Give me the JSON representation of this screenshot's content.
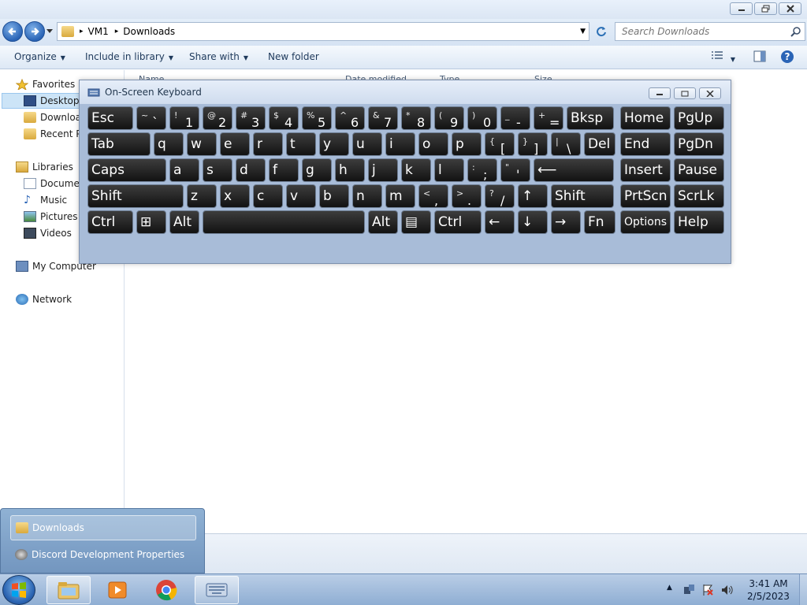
{
  "explorer": {
    "address": {
      "segments": [
        "VM1",
        "Downloads"
      ]
    },
    "search": {
      "placeholder": "Search Downloads"
    },
    "toolbar": {
      "organize": "Organize",
      "include": "Include in library",
      "share": "Share with",
      "new_folder": "New folder"
    },
    "columns": [
      "Name",
      "Date modified",
      "Type",
      "Size"
    ],
    "sidebar": {
      "favorites": "Favorites",
      "desktop": "Desktop",
      "downloads": "Downloads",
      "recent": "Recent Places",
      "libraries": "Libraries",
      "documents": "Documents",
      "music": "Music",
      "pictures": "Pictures",
      "videos": "Videos",
      "computer": "My Computer",
      "network": "Network"
    }
  },
  "osk": {
    "title": "On-Screen Keyboard",
    "rows": [
      [
        {
          "l": "Esc"
        },
        {
          "s": "~",
          "m": "`"
        },
        {
          "s": "!",
          "m": "1"
        },
        {
          "s": "@",
          "m": "2"
        },
        {
          "s": "#",
          "m": "3"
        },
        {
          "s": "$",
          "m": "4"
        },
        {
          "s": "%",
          "m": "5"
        },
        {
          "s": "^",
          "m": "6"
        },
        {
          "s": "&",
          "m": "7"
        },
        {
          "s": "*",
          "m": "8"
        },
        {
          "s": "(",
          "m": "9"
        },
        {
          "s": ")",
          "m": "0"
        },
        {
          "s": "_",
          "m": "-"
        },
        {
          "s": "+",
          "m": "="
        },
        {
          "l": "Bksp"
        },
        {
          "l": "Home"
        },
        {
          "l": "PgUp"
        }
      ],
      [
        {
          "l": "Tab"
        },
        {
          "l": "q"
        },
        {
          "l": "w"
        },
        {
          "l": "e"
        },
        {
          "l": "r"
        },
        {
          "l": "t"
        },
        {
          "l": "y"
        },
        {
          "l": "u"
        },
        {
          "l": "i"
        },
        {
          "l": "o"
        },
        {
          "l": "p"
        },
        {
          "s": "{",
          "m": "["
        },
        {
          "s": "}",
          "m": "]"
        },
        {
          "s": "|",
          "m": "\\"
        },
        {
          "l": "Del"
        },
        {
          "l": "End"
        },
        {
          "l": "PgDn"
        }
      ],
      [
        {
          "l": "Caps"
        },
        {
          "l": "a"
        },
        {
          "l": "s"
        },
        {
          "l": "d"
        },
        {
          "l": "f"
        },
        {
          "l": "g"
        },
        {
          "l": "h"
        },
        {
          "l": "j"
        },
        {
          "l": "k"
        },
        {
          "l": "l"
        },
        {
          "s": ":",
          "m": ";"
        },
        {
          "s": "\"",
          "m": "'"
        },
        {
          "l": "⟵"
        },
        {
          "l": "Insert"
        },
        {
          "l": "Pause"
        }
      ],
      [
        {
          "l": "Shift"
        },
        {
          "l": "z"
        },
        {
          "l": "x"
        },
        {
          "l": "c"
        },
        {
          "l": "v"
        },
        {
          "l": "b"
        },
        {
          "l": "n"
        },
        {
          "l": "m"
        },
        {
          "s": "<",
          "m": ","
        },
        {
          "s": ">",
          "m": "."
        },
        {
          "s": "?",
          "m": "/"
        },
        {
          "l": "↑"
        },
        {
          "l": "Shift"
        },
        {
          "l": "PrtScn"
        },
        {
          "l": "ScrLk"
        }
      ],
      [
        {
          "l": "Ctrl"
        },
        {
          "l": "⊞"
        },
        {
          "l": "Alt"
        },
        {
          "l": ""
        },
        {
          "l": "Alt"
        },
        {
          "l": "▤"
        },
        {
          "l": "Ctrl"
        },
        {
          "l": "←"
        },
        {
          "l": "↓"
        },
        {
          "l": "→"
        },
        {
          "l": "Fn"
        },
        {
          "l": "Options"
        },
        {
          "l": "Help"
        }
      ]
    ]
  },
  "jumplist": {
    "items": [
      "Downloads",
      "Discord Development Properties"
    ]
  },
  "tray": {
    "time": "3:41 AM",
    "date": "2/5/2023"
  },
  "taskbar_icons": [
    "windows-start-icon",
    "explorer-folder-icon",
    "media-player-icon",
    "chrome-icon",
    "keyboard-icon"
  ]
}
